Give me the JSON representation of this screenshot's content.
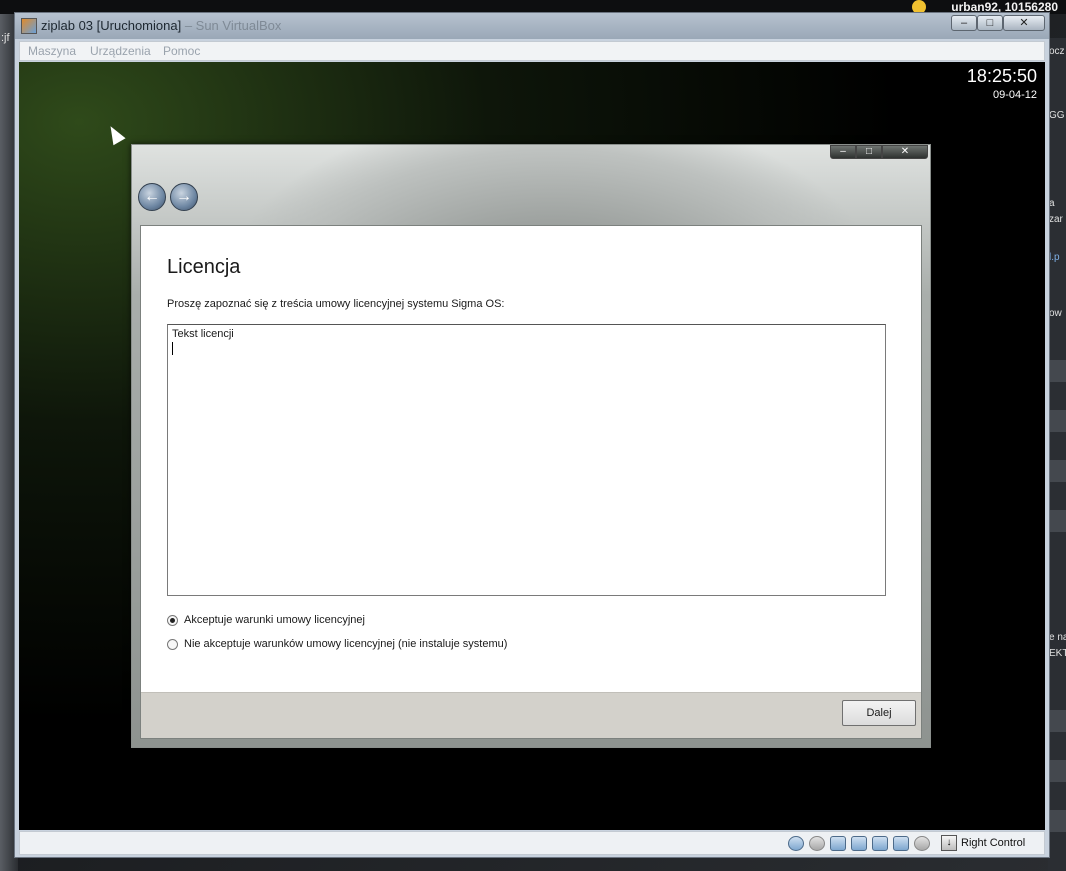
{
  "host": {
    "user_text": "urban92, 10156280",
    "left_fragment": ":jf",
    "right_fragments": [
      "ocz",
      "GG",
      "a",
      "zar",
      "l.p",
      "ow",
      "e na",
      "EKT"
    ]
  },
  "vbox": {
    "title": "ziplab 03 [Uruchomiona]",
    "title_suffix": " – Sun VirtualBox",
    "menu": [
      "Maszyna",
      "Urządzenia",
      "Pomoc"
    ],
    "host_key_label": "Right Control"
  },
  "guest": {
    "clock_time": "18:25:50",
    "clock_date": "09-04-12"
  },
  "installer": {
    "title": "Licencja",
    "subtitle": "Proszę zapoznać się z treścia umowy licencyjnej systemu Sigma OS:",
    "license_text": "Tekst licencji",
    "accept_label": "Akceptuje warunki umowy licencyjnej",
    "decline_label": "Nie akceptuje warunków umowy licencyjnej (nie instaluje systemu)",
    "selected_option": "accept",
    "next_label": "Dalej"
  },
  "icons": {
    "back": "arrow-left-icon",
    "forward": "arrow-right-icon",
    "statusbar": [
      "hard-disk-icon",
      "cd-icon",
      "network-icon",
      "usb-icon",
      "shared-folder-icon",
      "display-icon",
      "mouse-integration-icon",
      "host-key-icon"
    ]
  }
}
